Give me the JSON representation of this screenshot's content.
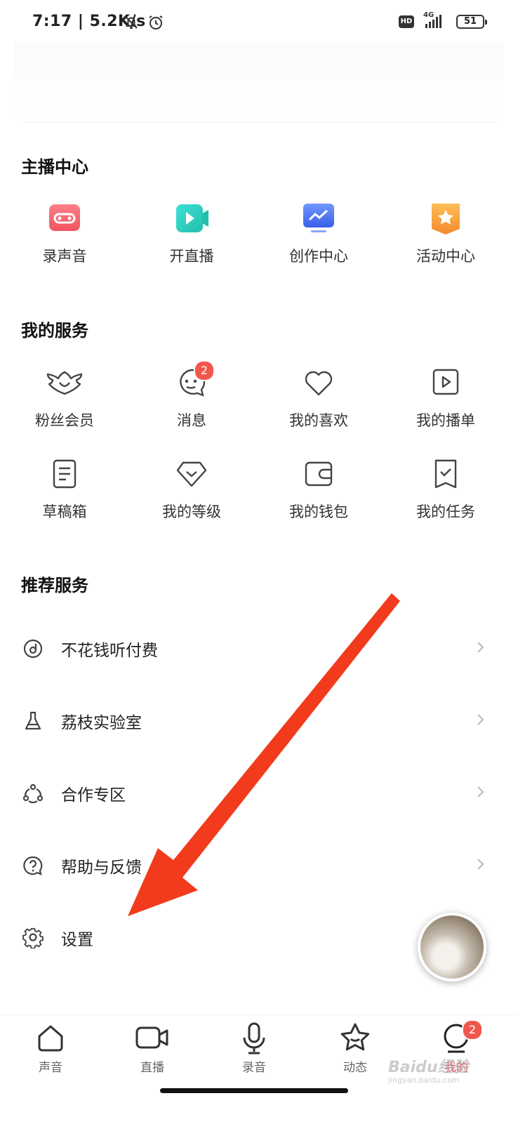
{
  "status_bar": {
    "time": "7:17 | 5.2K/s",
    "hd": "HD",
    "network": "4G",
    "battery": "51"
  },
  "anchor_center": {
    "title": "主播中心",
    "items": [
      {
        "label": "录声音",
        "icon": "record-sound-icon",
        "color": "#f4646e"
      },
      {
        "label": "开直播",
        "icon": "live-stream-icon",
        "color": "#2ed0c4"
      },
      {
        "label": "创作中心",
        "icon": "creation-center-icon",
        "color": "#4b7cf5"
      },
      {
        "label": "活动中心",
        "icon": "activity-center-icon",
        "color": "#f7a23b"
      }
    ]
  },
  "my_services": {
    "title": "我的服务",
    "items": [
      {
        "label": "粉丝会员",
        "icon": "fan-member-icon"
      },
      {
        "label": "消息",
        "icon": "message-icon",
        "badge": "2"
      },
      {
        "label": "我的喜欢",
        "icon": "heart-icon"
      },
      {
        "label": "我的播单",
        "icon": "playlist-icon"
      },
      {
        "label": "草稿箱",
        "icon": "draft-icon"
      },
      {
        "label": "我的等级",
        "icon": "level-icon"
      },
      {
        "label": "我的钱包",
        "icon": "wallet-icon"
      },
      {
        "label": "我的任务",
        "icon": "task-icon"
      }
    ]
  },
  "recommended": {
    "title": "推荐服务",
    "rows": [
      {
        "label": "不花钱听付费",
        "icon": "free-listen-icon"
      },
      {
        "label": "荔枝实验室",
        "icon": "lab-flask-icon"
      },
      {
        "label": "合作专区",
        "icon": "cooperation-icon"
      },
      {
        "label": "帮助与反馈",
        "icon": "help-icon"
      },
      {
        "label": "设置",
        "icon": "settings-gear-icon"
      }
    ]
  },
  "tabbar": {
    "tabs": [
      {
        "label": "声音",
        "icon": "home-icon"
      },
      {
        "label": "直播",
        "icon": "live-camera-icon"
      },
      {
        "label": "录音",
        "icon": "microphone-icon"
      },
      {
        "label": "动态",
        "icon": "star-icon"
      },
      {
        "label": "我的",
        "icon": "me-icon",
        "badge": "2",
        "active": true
      }
    ]
  },
  "watermark": {
    "brand": "Baidu经验",
    "url": "jingyan.baidu.com"
  },
  "colors": {
    "accent": "#e8555f",
    "badge": "#f2574d",
    "arrow": "#f23a1c"
  }
}
